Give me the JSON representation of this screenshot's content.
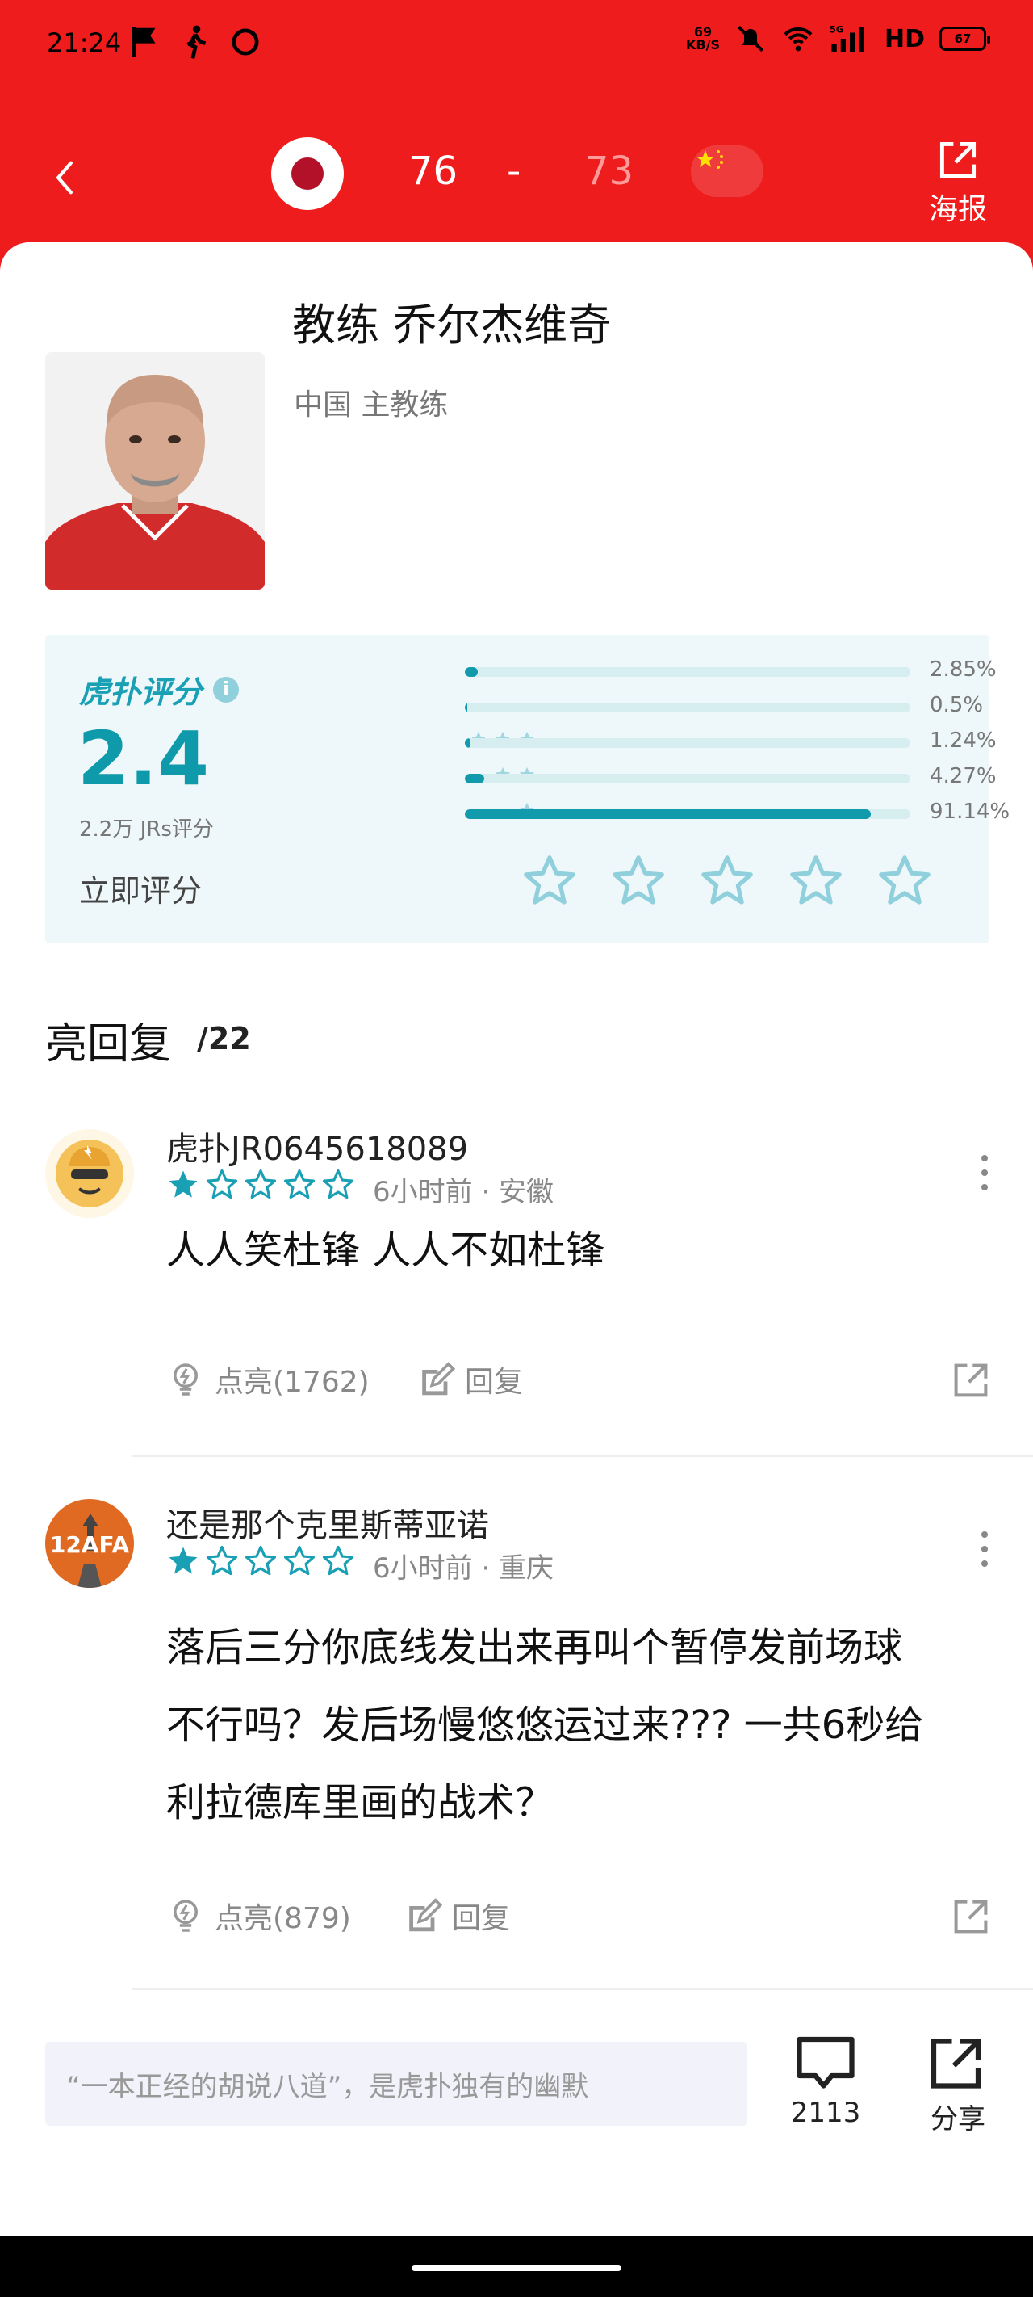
{
  "status_bar": {
    "time": "21:24",
    "net_speed_value": "69",
    "net_speed_unit": "KB/S",
    "network_type": "5G",
    "hd": "HD",
    "battery": "67"
  },
  "header": {
    "score_home": "76",
    "score_sep": "-",
    "score_away": "73",
    "poster_label": "海报"
  },
  "coach": {
    "name": "教练 乔尔杰维奇",
    "role": "中国 主教练"
  },
  "rating": {
    "brand": "虎扑评分",
    "score": "2.4",
    "count_text": "2.2万 JRs评分",
    "rate_now": "立即评分",
    "distribution": [
      {
        "stars": 5,
        "percent": 2.85,
        "label": "2.85%"
      },
      {
        "stars": 4,
        "percent": 0.5,
        "label": "0.5%"
      },
      {
        "stars": 3,
        "percent": 1.24,
        "label": "1.24%"
      },
      {
        "stars": 2,
        "percent": 4.27,
        "label": "4.27%"
      },
      {
        "stars": 1,
        "percent": 91.14,
        "label": "91.14%"
      }
    ]
  },
  "replies": {
    "title": "亮回复",
    "count": "/22",
    "items": [
      {
        "user": "虎扑JR0645618089",
        "stars": 1,
        "meta": "6小时前 · 安徽",
        "body": "人人笑杜锋 人人不如杜锋",
        "like_label": "点亮(1762)",
        "reply_label": "回复"
      },
      {
        "user": "还是那个克里斯蒂亚诺",
        "stars": 1,
        "meta": "6小时前 · 重庆",
        "body_lines": [
          "落后三分你底线发出来再叫个暂停发前场球",
          "不行吗？发后场慢悠悠运过来??? 一共6秒给",
          "利拉德库里画的战术？"
        ],
        "like_label": "点亮(879)",
        "reply_label": "回复",
        "avatar_text": "12AFA"
      }
    ]
  },
  "bottom": {
    "input_placeholder": "“一本正经的胡说八道”，是虎扑独有的幽默",
    "comment_count": "2113",
    "share_label": "分享"
  },
  "colors": {
    "header_red": "#ee1c1c",
    "accent_teal": "#119aab",
    "star_blue": "#1aa0b4"
  }
}
